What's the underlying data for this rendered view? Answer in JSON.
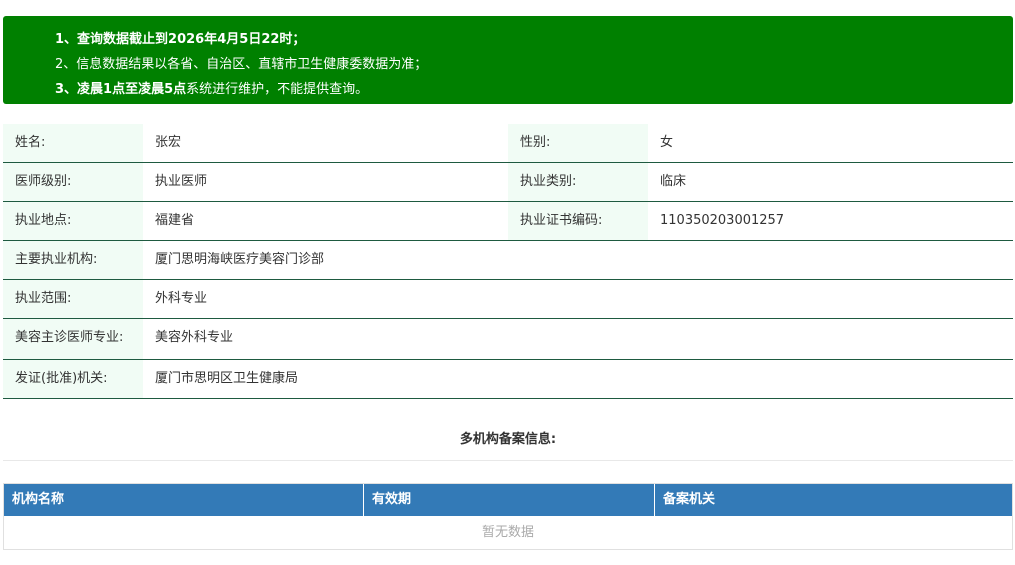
{
  "notice": {
    "line1": "1、查询数据截止到2026年4月5日22时；",
    "line2": "2、信息数据结果以各省、自治区、直辖市卫生健康委数据为准；",
    "line3_bold": "3、凌晨1点至凌晨5点",
    "line3_rest": "系统进行维护，不能提供查询。"
  },
  "info": {
    "name_label": "姓名:",
    "name": "张宏",
    "gender_label": "性别:",
    "gender": "女",
    "level_label": "医师级别:",
    "level": "执业医师",
    "category_label": "执业类别:",
    "category": "临床",
    "location_label": "执业地点:",
    "location": "福建省",
    "cert_label": "执业证书编码:",
    "cert": "110350203001257",
    "org_label": "主要执业机构:",
    "org": "厦门思明海峡医疗美容门诊部",
    "scope_label": "执业范围:",
    "scope": "外科专业",
    "cosmetic_label": "美容主诊医师专业:",
    "cosmetic": "美容外科专业",
    "authority_label": "发证(批准)机关:",
    "authority": "厦门市思明区卫生健康局"
  },
  "multi": {
    "title": "多机构备案信息:",
    "columns": [
      "机构名称",
      "有效期",
      "备案机关"
    ],
    "empty": "暂无数据"
  }
}
